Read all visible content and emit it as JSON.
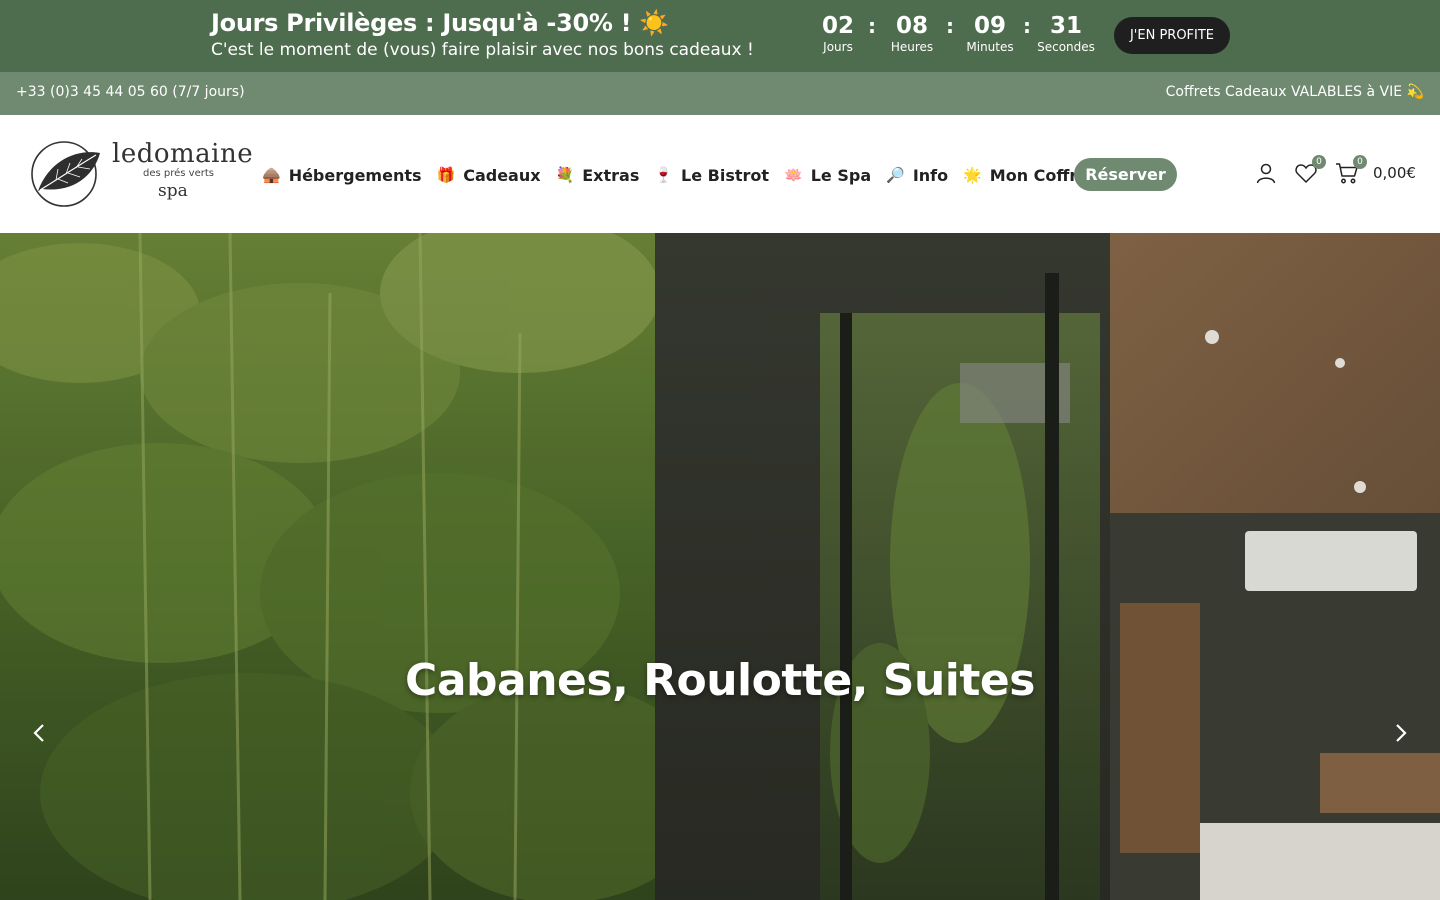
{
  "promo": {
    "title": "Jours Privilèges : Jusqu'à -30% ! ☀️",
    "subtitle": "C'est le moment de (vous) faire plaisir avec nos bons cadeaux !",
    "countdown": [
      {
        "value": "02",
        "label": "Jours"
      },
      {
        "value": "08",
        "label": "Heures"
      },
      {
        "value": "09",
        "label": "Minutes"
      },
      {
        "value": "31",
        "label": "Secondes"
      }
    ],
    "separator": ":",
    "cta_label": "J'EN PROFITE"
  },
  "infobar": {
    "phone": "+33 (0)3 45 44 05 60 (7/7 jours)",
    "right_text": "Coffrets Cadeaux VALABLES à VIE 💫"
  },
  "logo": {
    "line1": "ledomaine",
    "line2": "des prés verts",
    "line3": "spa"
  },
  "nav": {
    "items": [
      {
        "emoji": "🛖",
        "label": "Hébergements"
      },
      {
        "emoji": "🎁",
        "label": "Cadeaux"
      },
      {
        "emoji": "💐",
        "label": "Extras"
      },
      {
        "emoji": "🍷",
        "label": "Le Bistrot"
      },
      {
        "emoji": "🪷",
        "label": "Le Spa"
      },
      {
        "emoji": "🔎",
        "label": "Info"
      },
      {
        "emoji": "🌟",
        "label": "Mon Coffret"
      }
    ],
    "reserve_label": "Réserver"
  },
  "header_actions": {
    "account_icon": "user-icon",
    "wishlist_icon": "heart-icon",
    "wishlist_count": "0",
    "cart_icon": "cart-icon",
    "cart_count": "0",
    "cart_total": "0,00€"
  },
  "hero": {
    "headline": "Cabanes, Roulotte, Suites",
    "prev_icon": "chevron-left-icon",
    "next_icon": "chevron-right-icon"
  },
  "colors": {
    "promo_bg": "#4e6c4e",
    "infobar_bg": "#6f8a70",
    "accent": "#6f8a70",
    "cta_bg": "#1f1f1f"
  }
}
